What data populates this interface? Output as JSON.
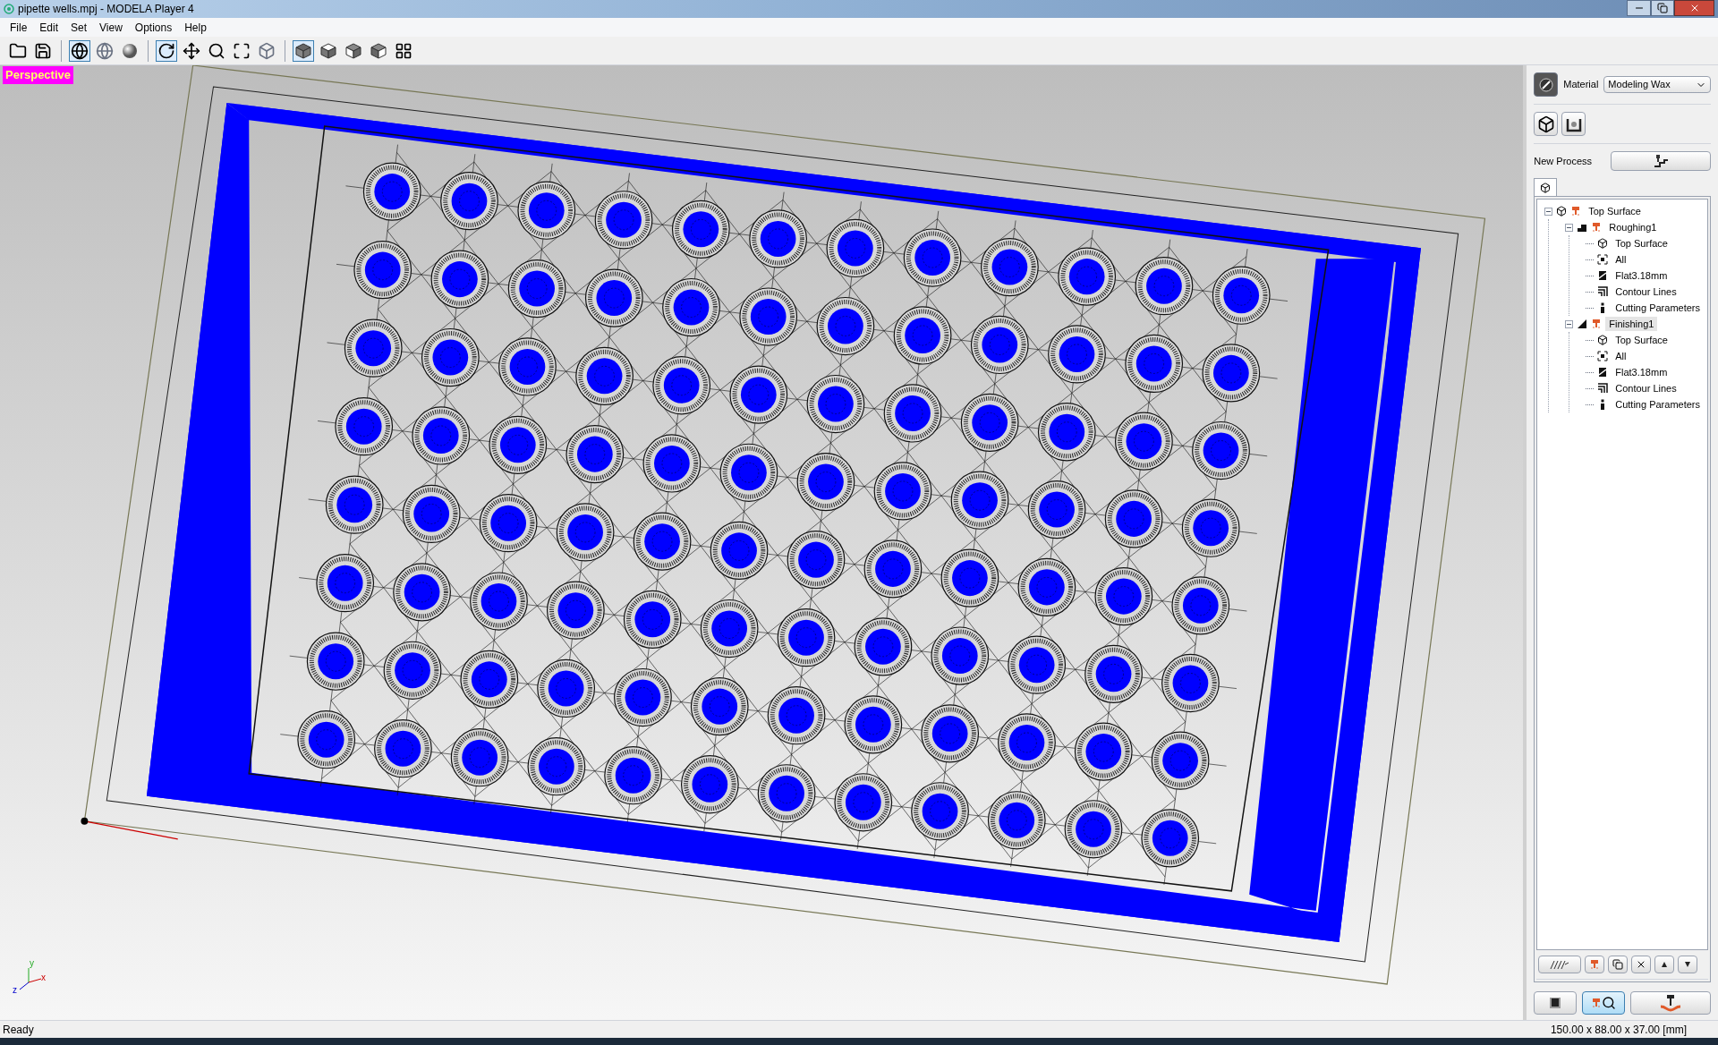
{
  "window": {
    "title": "pipette wells.mpj - MODELA Player 4"
  },
  "menu": [
    "File",
    "Edit",
    "Set",
    "View",
    "Options",
    "Help"
  ],
  "toolbar": [
    {
      "kind": "open",
      "selected": false
    },
    {
      "kind": "save",
      "selected": false
    },
    {
      "kind": "sep"
    },
    {
      "kind": "wire",
      "selected": true
    },
    {
      "kind": "globe",
      "selected": false
    },
    {
      "kind": "sphere",
      "selected": false
    },
    {
      "kind": "sep"
    },
    {
      "kind": "rotate",
      "selected": true
    },
    {
      "kind": "move",
      "selected": false
    },
    {
      "kind": "zoom",
      "selected": false
    },
    {
      "kind": "fit",
      "selected": false
    },
    {
      "kind": "fitbox",
      "selected": false
    },
    {
      "kind": "sep"
    },
    {
      "kind": "cube",
      "selected": true
    },
    {
      "kind": "cubetop",
      "selected": false
    },
    {
      "kind": "cubefront",
      "selected": false
    },
    {
      "kind": "cubeside",
      "selected": false
    },
    {
      "kind": "views",
      "selected": false
    }
  ],
  "viewport": {
    "label": "Perspective",
    "axis_labels": [
      "y",
      "z",
      "x"
    ]
  },
  "panel": {
    "material": {
      "label": "Material",
      "value": "Modeling Wax"
    },
    "new_process": {
      "label": "New Process"
    },
    "tree": [
      {
        "label": "Top Surface",
        "kind": "surface",
        "expanded": true,
        "selected": false,
        "children": [
          {
            "label": "Roughing1",
            "kind": "roughing",
            "expanded": true,
            "selected": false,
            "children": [
              {
                "label": "Top Surface",
                "kind": "surface",
                "selected": false
              },
              {
                "label": "All",
                "kind": "area",
                "selected": false
              },
              {
                "label": "Flat3.18mm",
                "kind": "tool",
                "selected": false
              },
              {
                "label": "Contour Lines",
                "kind": "path",
                "selected": false
              },
              {
                "label": "Cutting Parameters",
                "kind": "parameters",
                "selected": false
              }
            ]
          },
          {
            "label": "Finishing1",
            "kind": "finishing",
            "expanded": true,
            "selected": true,
            "children": [
              {
                "label": "Top Surface",
                "kind": "surface",
                "selected": false
              },
              {
                "label": "All",
                "kind": "area",
                "selected": false
              },
              {
                "label": "Flat3.18mm",
                "kind": "tool",
                "selected": false
              },
              {
                "label": "Contour Lines",
                "kind": "path",
                "selected": false
              },
              {
                "label": "Cutting Parameters",
                "kind": "parameters",
                "selected": false
              }
            ]
          }
        ]
      }
    ],
    "bottom_buttons": [
      {
        "kind": "preview",
        "selected": false
      },
      {
        "kind": "inspect",
        "selected": true
      },
      {
        "kind": "cut",
        "selected": false
      }
    ]
  },
  "status_bar": {
    "message": "Ready",
    "dimensions": "150.00 x 88.00 x 37.00 [mm]"
  }
}
